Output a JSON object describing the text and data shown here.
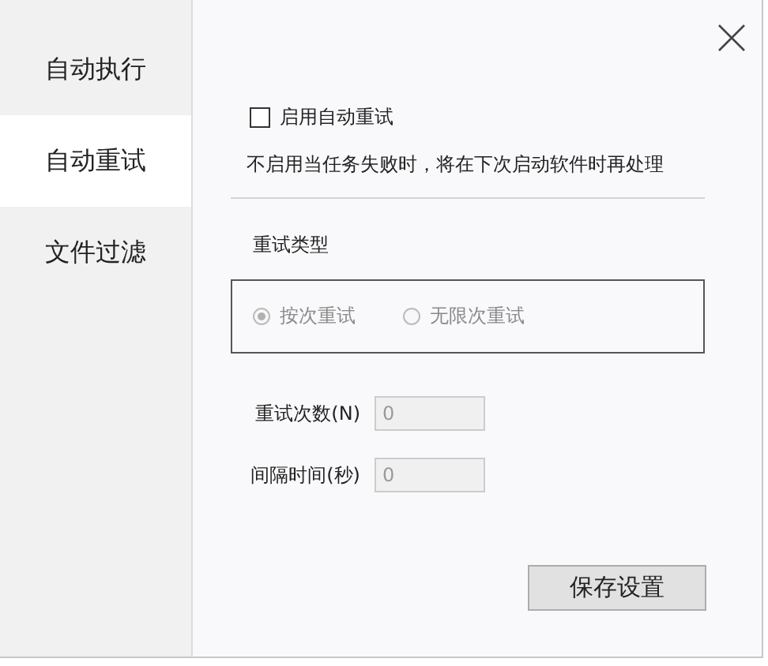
{
  "sidebar": {
    "items": [
      {
        "label": "自动执行",
        "selected": false
      },
      {
        "label": "自动重试",
        "selected": true
      },
      {
        "label": "文件过滤",
        "selected": false
      }
    ]
  },
  "enable_checkbox": {
    "label": "启用自动重试",
    "checked": false
  },
  "description": "不启用当任务失败时，将在下次启动软件时再处理",
  "retry_type": {
    "title": "重试类型",
    "options": [
      {
        "label": "按次重试",
        "selected": true,
        "disabled": true
      },
      {
        "label": "无限次重试",
        "selected": false,
        "disabled": true
      }
    ]
  },
  "fields": [
    {
      "label": "重试次数(N)",
      "value": "0",
      "disabled": true
    },
    {
      "label": "间隔时间(秒)",
      "value": "0",
      "disabled": true
    }
  ],
  "save_button": "保存设置"
}
